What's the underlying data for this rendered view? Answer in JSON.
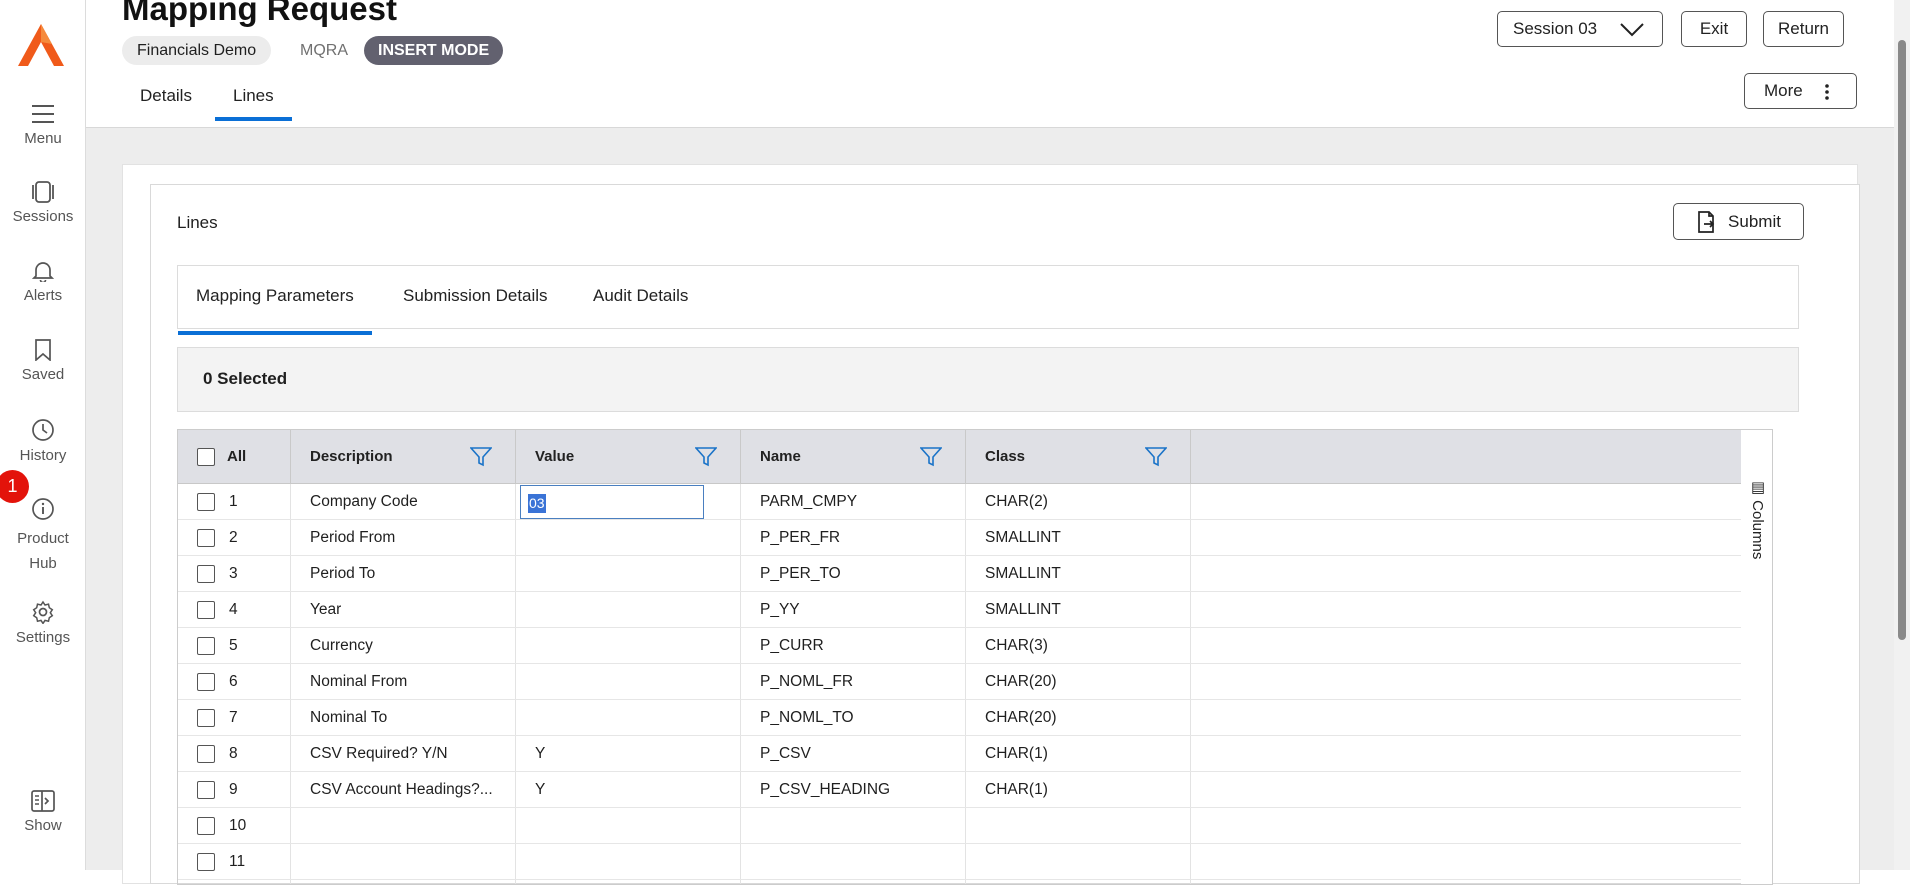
{
  "sidebar": {
    "items": [
      {
        "label": "Menu",
        "icon": "hamburger-icon"
      },
      {
        "label": "Sessions",
        "icon": "sessions-icon"
      },
      {
        "label": "Alerts",
        "icon": "bell-icon"
      },
      {
        "label": "Saved",
        "icon": "bookmark-icon"
      },
      {
        "label": "History",
        "icon": "clock-icon"
      },
      {
        "label": "Product Hub",
        "icon": "info-icon"
      },
      {
        "label": "Settings",
        "icon": "gear-icon"
      },
      {
        "label": "Show",
        "icon": "panel-toggle-icon"
      }
    ],
    "badge": "1"
  },
  "header": {
    "title": "Mapping Request",
    "company": "Financials Demo",
    "code": "MQRA",
    "mode": "INSERT MODE",
    "session": "Session 03",
    "exit": "Exit",
    "return": "Return",
    "more": "More",
    "tabs": [
      "Details",
      "Lines"
    ]
  },
  "lines": {
    "title": "Lines",
    "submit": "Submit",
    "tabs": [
      "Mapping Parameters",
      "Submission Details",
      "Audit Details"
    ],
    "selected": "0 Selected",
    "columns_toggle": "Columns",
    "grid": {
      "all_label": "All",
      "headers": [
        "Description",
        "Value",
        "Name",
        "Class"
      ],
      "rows": [
        {
          "num": "1",
          "description": "Company Code",
          "value": "03",
          "name": "PARM_CMPY",
          "class": "CHAR(2)"
        },
        {
          "num": "2",
          "description": "Period From",
          "value": "",
          "name": "P_PER_FR",
          "class": "SMALLINT"
        },
        {
          "num": "3",
          "description": "Period To",
          "value": "",
          "name": "P_PER_TO",
          "class": "SMALLINT"
        },
        {
          "num": "4",
          "description": "Year",
          "value": "",
          "name": "P_YY",
          "class": "SMALLINT"
        },
        {
          "num": "5",
          "description": "Currency",
          "value": "",
          "name": "P_CURR",
          "class": "CHAR(3)"
        },
        {
          "num": "6",
          "description": "Nominal From",
          "value": "",
          "name": "P_NOML_FR",
          "class": "CHAR(20)"
        },
        {
          "num": "7",
          "description": "Nominal To",
          "value": "",
          "name": "P_NOML_TO",
          "class": "CHAR(20)"
        },
        {
          "num": "8",
          "description": "CSV Required? Y/N",
          "value": "Y",
          "name": "P_CSV",
          "class": "CHAR(1)"
        },
        {
          "num": "9",
          "description": "CSV Account Headings?...",
          "value": "Y",
          "name": "P_CSV_HEADING",
          "class": "CHAR(1)"
        },
        {
          "num": "10",
          "description": "",
          "value": "",
          "name": "",
          "class": ""
        },
        {
          "num": "11",
          "description": "",
          "value": "",
          "name": "",
          "class": ""
        }
      ]
    }
  },
  "colors": {
    "accent": "#0a6fd6",
    "logo": "#f05a1a",
    "badge": "#e3130b",
    "mode_chip": "#62616f"
  }
}
